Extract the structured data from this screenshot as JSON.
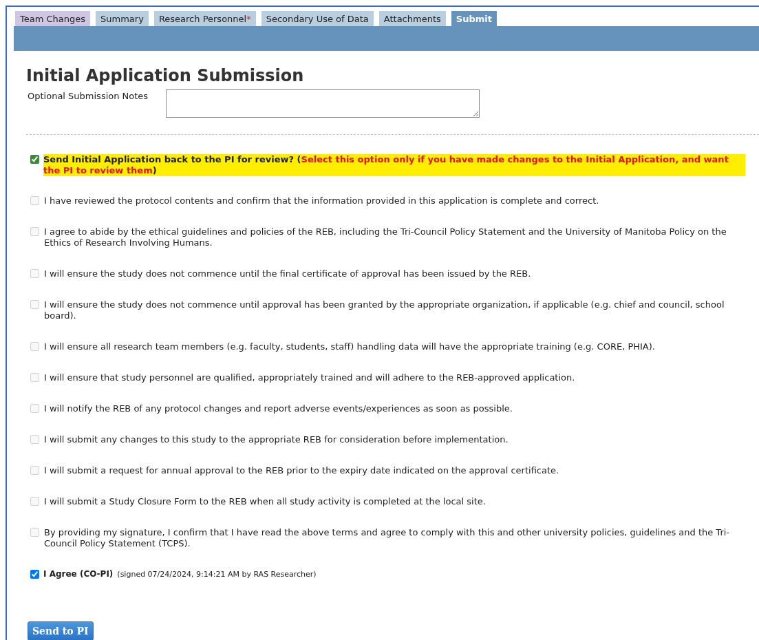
{
  "tabs": [
    {
      "label": "Team Changes",
      "selected": false,
      "color": "#cfc6e3"
    },
    {
      "label": "Summary",
      "selected": false,
      "color": "#b9cedf"
    },
    {
      "label": "Research Personnel",
      "required": true,
      "selected": false,
      "color": "#b9cedf"
    },
    {
      "label": "Secondary Use of Data",
      "selected": false,
      "color": "#b9cedf"
    },
    {
      "label": "Attachments",
      "selected": false,
      "color": "#b9cedf"
    },
    {
      "label": "Submit",
      "selected": true,
      "color": "#6693bb"
    }
  ],
  "required_mark": "*",
  "title": "Initial Application Submission",
  "notes_field": {
    "label": "Optional Submission Notes"
  },
  "send_back": {
    "checked": true,
    "text": "Send Initial Application back to the PI for review? (",
    "note": "Select this option only if you have made changes to the Initial Application, and want the PI to review them",
    "closing": ")"
  },
  "statements": [
    {
      "text": "I have reviewed the protocol contents and confirm that the information provided in this application is complete and correct.",
      "checked": false,
      "disabled": true
    },
    {
      "text": "I agree to abide by the ethical guidelines and policies of the REB, including the Tri-Council Policy Statement and the University of Manitoba Policy on the Ethics of Research Involving Humans.",
      "checked": false,
      "disabled": true
    },
    {
      "text": "I will ensure the study does not commence until the final certificate of approval has been issued by the REB.",
      "checked": false,
      "disabled": true
    },
    {
      "text": "I will ensure the study does not commence until approval has been granted by the appropriate organization, if applicable (e.g. chief and council, school board).",
      "checked": false,
      "disabled": true
    },
    {
      "text": "I will ensure all research team members (e.g. faculty, students, staff) handling data will have the appropriate training (e.g. CORE, PHIA).",
      "checked": false,
      "disabled": true
    },
    {
      "text": "I will ensure that study personnel are qualified, appropriately trained and will adhere to the REB-approved application.",
      "checked": false,
      "disabled": true
    },
    {
      "text": "I will notify the REB of any protocol changes and report adverse events/experiences as soon as possible.",
      "checked": false,
      "disabled": true
    },
    {
      "text": "I will submit any changes to this study to the appropriate REB for consideration before implementation.",
      "checked": false,
      "disabled": true
    },
    {
      "text": "I will submit a request for annual approval to the REB prior to the expiry date indicated on the approval certificate.",
      "checked": false,
      "disabled": true
    },
    {
      "text": "I will submit a Study Closure Form to the REB when all study activity is completed at the local site.",
      "checked": false,
      "disabled": true
    },
    {
      "text": "By providing my signature, I confirm that I have read the above terms and agree to comply with this and other university policies, guidelines and the Tri-Council Policy Statement (TCPS).",
      "checked": false,
      "disabled": true
    }
  ],
  "agree": {
    "checked": true,
    "label": "I Agree (CO-PI)",
    "signature": "(signed 07/24/2024, 9:14:21 AM by RAS Researcher)"
  },
  "submit_button": "Send to PI"
}
